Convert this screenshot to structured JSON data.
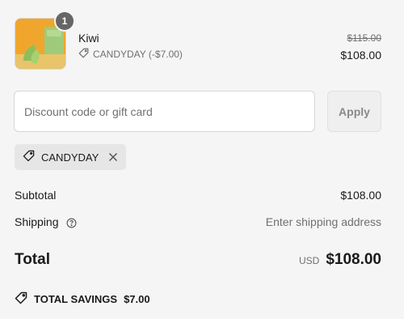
{
  "product": {
    "name": "Kiwi",
    "quantity": "1",
    "discount_label": "CANDYDAY (-$7.00)",
    "original_price": "$115.00",
    "price": "$108.00",
    "image_icon": "product-thumbnail"
  },
  "discount": {
    "placeholder": "Discount code or gift card",
    "value": "",
    "apply_label": "Apply",
    "applied_code": "CANDYDAY"
  },
  "summary": {
    "subtotal_label": "Subtotal",
    "subtotal_value": "$108.00",
    "shipping_label": "Shipping",
    "shipping_value": "Enter shipping address",
    "total_label": "Total",
    "currency": "USD",
    "total_value": "$108.00",
    "savings_label": "TOTAL SAVINGS",
    "savings_value": "$7.00"
  },
  "colors": {
    "background": "#f5f5f5",
    "badge": "#666666",
    "muted_text": "#707070",
    "product_image": "#f0a62d",
    "product_box": "#9ecb7a"
  }
}
